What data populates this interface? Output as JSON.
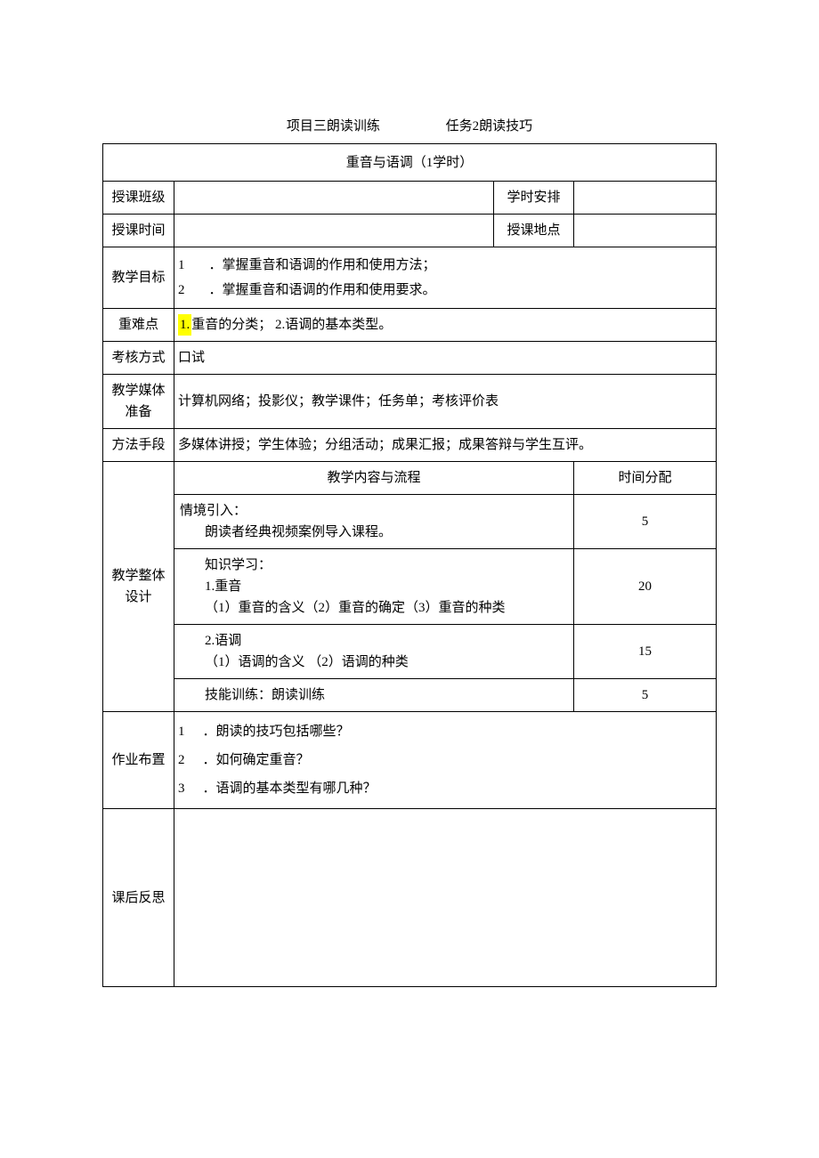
{
  "header": {
    "left": "项目三朗读训练",
    "right": "任务2朗读技巧"
  },
  "title": "重音与语调（1学时）",
  "meta": {
    "class_label": "授课班级",
    "class_value": "",
    "hours_label": "学时安排",
    "hours_value": "",
    "time_label": "授课时间",
    "time_value": "",
    "place_label": "授课地点",
    "place_value": ""
  },
  "goals": {
    "label": "教学目标",
    "items": [
      {
        "num": "1",
        "text": "．掌握重音和语调的作用和使用方法；"
      },
      {
        "num": "2",
        "text": "．掌握重音和语调的作用和使用要求。"
      }
    ]
  },
  "difficulties": {
    "label": "重难点",
    "highlighted": "1.",
    "line1_rest": "重音的分类；",
    "line2": "2.语调的基本类型。"
  },
  "assessment": {
    "label": "考核方式",
    "value": "口试"
  },
  "media": {
    "label": "教学媒体准备",
    "value": "计算机网络；投影仪；教学课件；任务单；考核评价表"
  },
  "methods": {
    "label": "方法手段",
    "value": "多媒体讲授；学生体验；分组活动；成果汇报；成果答辩与学生互评。"
  },
  "design": {
    "label": "教学整体设计",
    "header_left": "教学内容与流程",
    "header_right": "时间分配",
    "rows": [
      {
        "lines": [
          "情境引入：",
          "    朗读者经典视频案例导入课程。"
        ],
        "time": "5"
      },
      {
        "lines": [
          "  知识学习：",
          "  1.重音",
          "  （1）重音的含义（2）重音的确定（3）重音的种类"
        ],
        "time": "20"
      },
      {
        "lines": [
          "  2.语调",
          "  （1）语调的含义      （2）语调的种类"
        ],
        "time": "15"
      },
      {
        "lines": [
          "  技能训练：朗读训练"
        ],
        "time": "5"
      }
    ]
  },
  "homework": {
    "label": "作业布置",
    "items": [
      {
        "num": "1",
        "text": "．朗读的技巧包括哪些？"
      },
      {
        "num": "2",
        "text": "．如何确定重音？"
      },
      {
        "num": "3",
        "text": "．语调的基本类型有哪几种？"
      }
    ]
  },
  "reflection": {
    "label": "课后反思",
    "value": ""
  }
}
